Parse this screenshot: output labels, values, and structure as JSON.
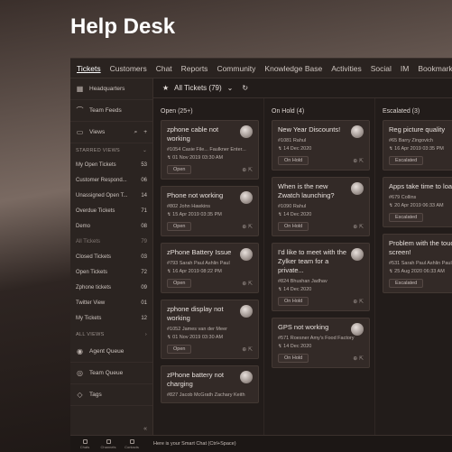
{
  "hero_title": "Help Desk",
  "topnav": [
    "Tickets",
    "Customers",
    "Chat",
    "Reports",
    "Community",
    "Knowledge Base",
    "Activities",
    "Social",
    "IM",
    "Bookmarks"
  ],
  "sidebar": {
    "headquarters": "Headquarters",
    "team_feeds": "Team Feeds",
    "views": "Views",
    "starred_views": "STARRED VIEWS",
    "starred": [
      {
        "label": "My Open Tickets",
        "count": "53"
      },
      {
        "label": "Customer Respond...",
        "count": "06"
      },
      {
        "label": "Unassigned Open T...",
        "count": "14"
      },
      {
        "label": "Overdue Tickets",
        "count": "71"
      },
      {
        "label": "Demo",
        "count": "08"
      },
      {
        "label": "All Tickets",
        "count": "79"
      },
      {
        "label": "Closed Tickets",
        "count": "03"
      },
      {
        "label": "Open Tickets",
        "count": "72"
      },
      {
        "label": "Zphone tickets",
        "count": "09"
      },
      {
        "label": "Twitter View",
        "count": "01"
      },
      {
        "label": "My Tickets",
        "count": "12"
      }
    ],
    "all_views": "ALL VIEWS",
    "agent_queue": "Agent Queue",
    "team_queue": "Team Queue",
    "tags": "Tags"
  },
  "main": {
    "view_title": "All Tickets (79)",
    "columns": [
      {
        "title": "Open (25+)",
        "cards": [
          {
            "title": "zphone cable not working",
            "meta": "#1054   Casie File...   Faulkner Enter...",
            "date": "01 Nov 2019 03:30 AM",
            "badge": "Open"
          },
          {
            "title": "Phone not working",
            "meta": "#802   John Hawkins",
            "date": "15 Apr 2019 03:35 PM",
            "badge": "Open"
          },
          {
            "title": "zPhone Battery Issue",
            "meta": "#793   Sarah Paul   Ashlin Paul",
            "date": "16 Apr 2019 08:22 PM",
            "badge": "Open"
          },
          {
            "title": "zphone display not working",
            "meta": "#1052   James van der Meer",
            "date": "01 Nov 2019 03:30 AM",
            "badge": "Open"
          },
          {
            "title": "zPhone battery not charging",
            "meta": "#827   Jacob McGrath   Zachary Keith",
            "date": "",
            "badge": ""
          }
        ]
      },
      {
        "title": "On Hold (4)",
        "cards": [
          {
            "title": "New Year Discounts!",
            "meta": "#1081   Rahul",
            "date": "14 Dec 2020",
            "badge": "On Hold"
          },
          {
            "title": "When is the new Zwatch launching?",
            "meta": "#1090   Rahul",
            "date": "14 Dec 2020",
            "badge": "On Hold"
          },
          {
            "title": "I'd like to meet with the Zylker team for a private...",
            "meta": "#824   Bhushan Jadhav",
            "date": "14 Dec 2020",
            "badge": "On Hold"
          },
          {
            "title": "GPS not working",
            "meta": "#571   Roesner   Amy's Food Factory",
            "date": "14 Dec 2020",
            "badge": "On Hold"
          }
        ]
      },
      {
        "title": "Escalated (3)",
        "cards": [
          {
            "title": "Reg picture quality",
            "meta": "#65   Barry Zingovich",
            "date": "16 Apr 2019 03:35 PM",
            "badge": "Escalated"
          },
          {
            "title": "Apps take time to load",
            "meta": "#679   Collins",
            "date": "20 Apr 2019 06:33 AM",
            "badge": "Escalated"
          },
          {
            "title": "Problem with the touch screen!",
            "meta": "#531   Sarah Paul   Ashlin Paul",
            "date": "25 Aug 2020 06:33 AM",
            "badge": "Escalated"
          }
        ]
      }
    ]
  },
  "bottombar": {
    "items": [
      "Chats",
      "Channels",
      "Contacts"
    ],
    "smart_chat": "Here is your Smart Chat (Ctrl+Space)"
  }
}
